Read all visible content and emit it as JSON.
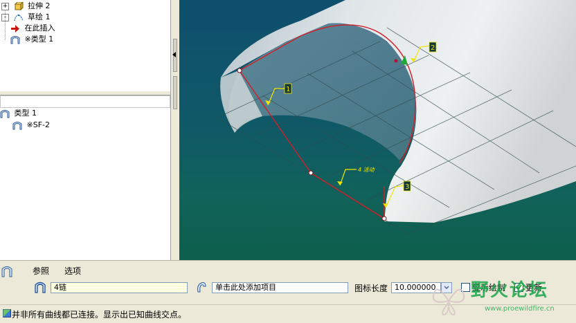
{
  "model_tree": {
    "items": [
      {
        "label": "拉伸 2",
        "icon": "extrude-icon",
        "expander": "+"
      },
      {
        "label": "草绘 1",
        "icon": "sketch-icon",
        "expander": "-"
      },
      {
        "label": "在此插入",
        "icon": "insert-here-arrow-icon"
      },
      {
        "label": "※类型 1",
        "icon": "boundary-blend-icon"
      }
    ]
  },
  "feature_tree": {
    "items": [
      {
        "label": "类型 1",
        "icon": "boundary-blend-icon"
      },
      {
        "label": "※SF-2",
        "icon": "boundary-blend-icon"
      }
    ]
  },
  "viewport": {
    "callouts": [
      "1",
      "2",
      "3",
      "4"
    ],
    "annotation_text": "4  活动"
  },
  "dashboard": {
    "tabs": {
      "references": "参照",
      "options": "选项"
    },
    "chain_field": "4链",
    "add_item_field": "单击此处添加项目",
    "icon_length_label": "图标长度",
    "icon_length_value": "10.000000",
    "show_draw_label": "显示绘制",
    "update_label": "更新"
  },
  "status": {
    "message": "并非所有曲线都已连接。显示出已知曲线交点。"
  },
  "watermark": {
    "brand": "野火论坛",
    "url": "www.proewildfire.cn"
  },
  "colors": {
    "curve": "#d21f26",
    "callout": "#f2e500",
    "field_yellow": "#ffffe1",
    "watermark_green": "#19a64b"
  }
}
